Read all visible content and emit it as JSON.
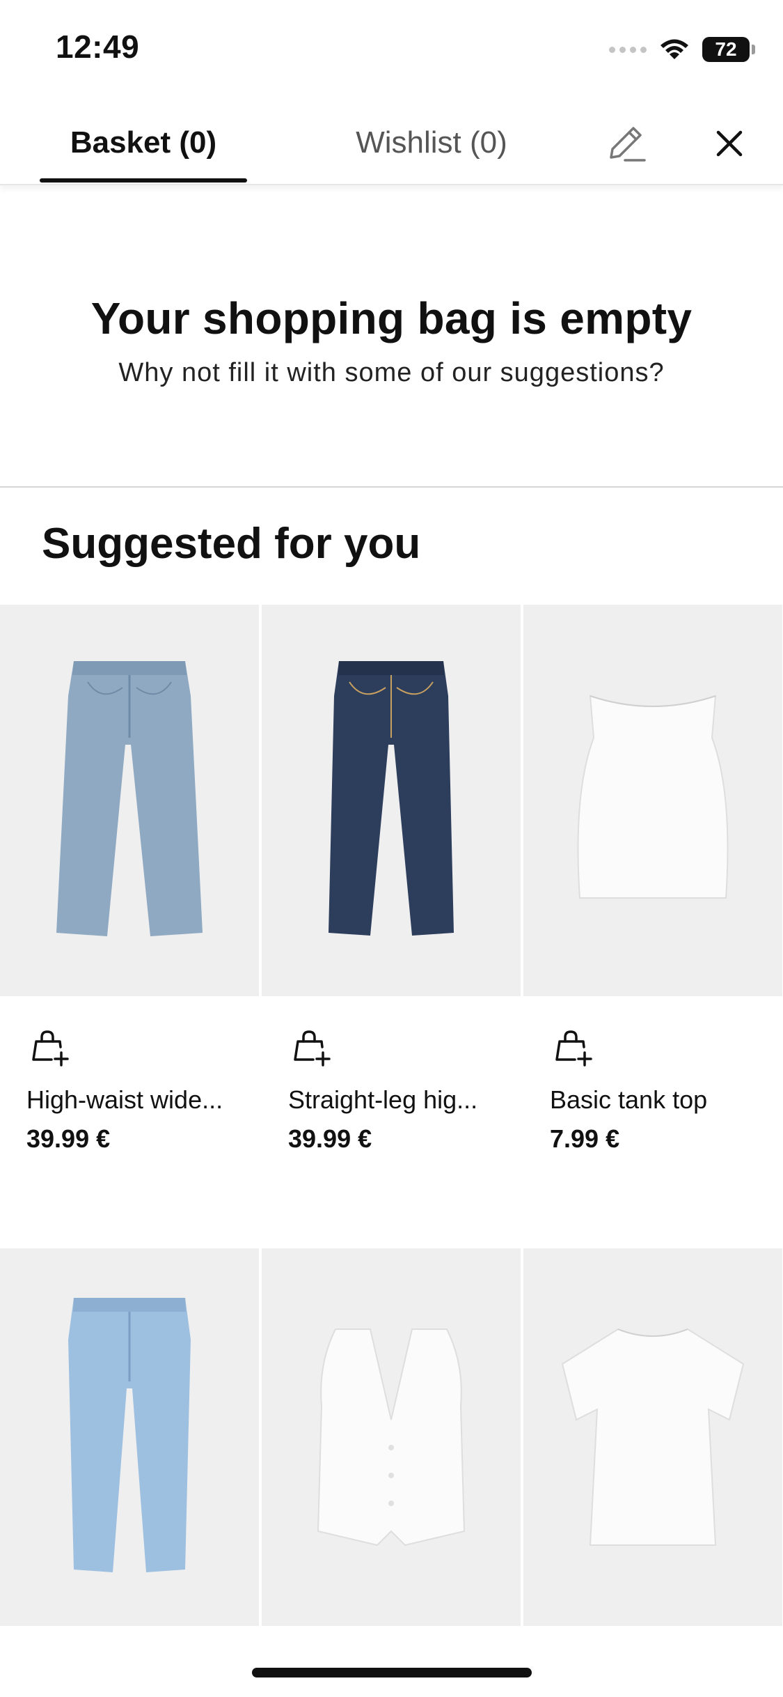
{
  "status_bar": {
    "time": "12:49",
    "battery": "72"
  },
  "tabs": {
    "basket": "Basket (0)",
    "wishlist": "Wishlist (0)"
  },
  "empty_state": {
    "title": "Your shopping bag is empty",
    "subtitle": "Why not fill it with some of our suggestions?"
  },
  "suggestions": {
    "title": "Suggested for you",
    "products": [
      {
        "name": "High-waist wide...",
        "price": "39.99 €",
        "image": "light-wash-wide-leg-jeans"
      },
      {
        "name": "Straight-leg hig...",
        "price": "39.99 €",
        "image": "dark-wash-straight-jeans"
      },
      {
        "name": "Basic tank top",
        "price": "7.99 €",
        "image": "white-tank-top"
      },
      {
        "image": "light-blue-mom-jeans"
      },
      {
        "image": "white-vest"
      },
      {
        "image": "white-t-shirt"
      }
    ]
  },
  "icons": [
    "pencil-icon",
    "close-icon",
    "wifi-icon",
    "add-to-bag-icon"
  ],
  "colors": {
    "text": "#111111",
    "tab_inactive": "#555555",
    "image_bg": "#efefef",
    "divider": "#d6d6d6"
  }
}
